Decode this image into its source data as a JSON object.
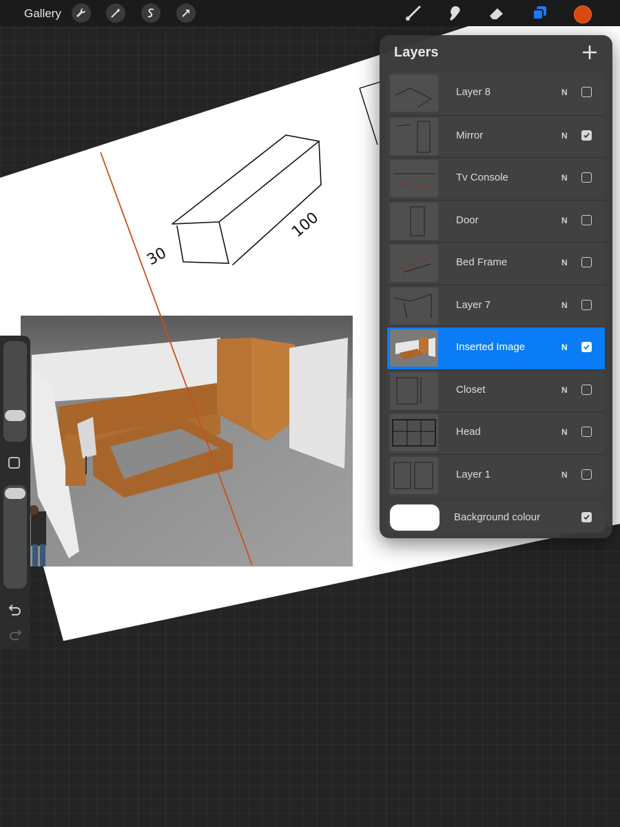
{
  "toolbar": {
    "gallery_label": "Gallery",
    "left_tools": [
      "wrench-icon",
      "magic-wand-icon",
      "selection-icon",
      "transform-icon"
    ],
    "right_tools": [
      "brush-icon",
      "smudge-icon",
      "eraser-icon",
      "layers-icon"
    ],
    "active_color": "#d9480f"
  },
  "canvas": {
    "sketch_labels": {
      "height": "30",
      "length": "100"
    }
  },
  "sidebar": {
    "brush_size_level": 0.3,
    "opacity_level": 0.05,
    "buttons": [
      "undo-icon",
      "redo-icon"
    ]
  },
  "layers_panel": {
    "title": "Layers",
    "layers": [
      {
        "name": "Layer 8",
        "blend": "N",
        "visible": false,
        "selected": false
      },
      {
        "name": "Mirror",
        "blend": "N",
        "visible": true,
        "selected": false
      },
      {
        "name": "Tv Console",
        "blend": "N",
        "visible": false,
        "selected": false
      },
      {
        "name": "Door",
        "blend": "N",
        "visible": false,
        "selected": false
      },
      {
        "name": "Bed Frame",
        "blend": "N",
        "visible": false,
        "selected": false
      },
      {
        "name": "Layer 7",
        "blend": "N",
        "visible": false,
        "selected": false
      },
      {
        "name": "Inserted Image",
        "blend": "N",
        "visible": true,
        "selected": true
      },
      {
        "name": "Closet",
        "blend": "N",
        "visible": false,
        "selected": false
      },
      {
        "name": "Head",
        "blend": "N",
        "visible": false,
        "selected": false
      },
      {
        "name": "Layer 1",
        "blend": "N",
        "visible": false,
        "selected": false
      }
    ],
    "background": {
      "label": "Background colour",
      "visible": true,
      "color": "#ffffff"
    }
  },
  "colors": {
    "accent": "#0a7cf5",
    "stroke": "#c8501a"
  }
}
